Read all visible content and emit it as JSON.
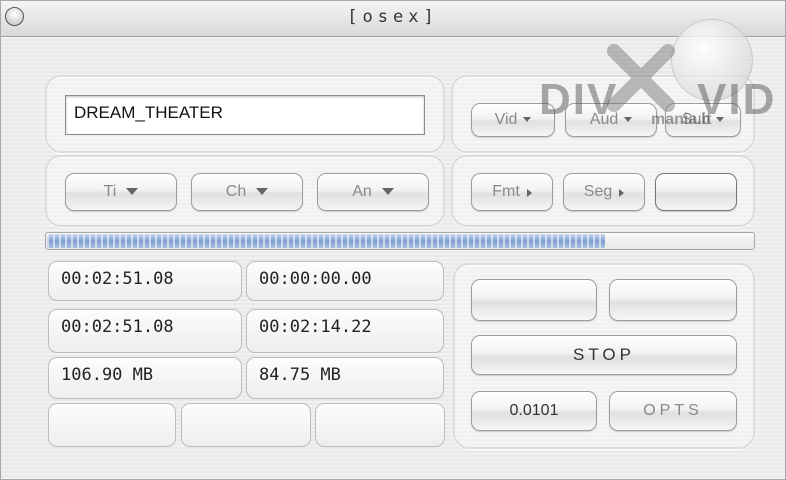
{
  "window": {
    "title": "[osex]"
  },
  "filename": {
    "value": "DREAM_THEATER"
  },
  "stream_buttons": {
    "vid": "Vid",
    "aud": "Aud",
    "sub": "Sub"
  },
  "selectors": {
    "title": "Ti",
    "chapter": "Ch",
    "angle": "An"
  },
  "format_buttons": {
    "fmt": "Fmt",
    "seg": "Seg",
    "extra": ""
  },
  "progress": {
    "fraction": 0.79
  },
  "times": {
    "t1": "00:02:51.08",
    "t2": "00:00:00.00",
    "t3": "00:02:51.08",
    "t4": "00:02:14.22",
    "size1": "106.90 MB",
    "size2": "84.75 MB"
  },
  "controls": {
    "stop": "STOP",
    "value": "0.0101",
    "opts": "OPTS"
  },
  "watermark": {
    "left": "DIV",
    "right": "VID",
    "small": "mania.it"
  },
  "icons": {
    "close": "close-icon",
    "dropdown": "chevron-down-icon",
    "submenu": "chevron-right-icon"
  }
}
